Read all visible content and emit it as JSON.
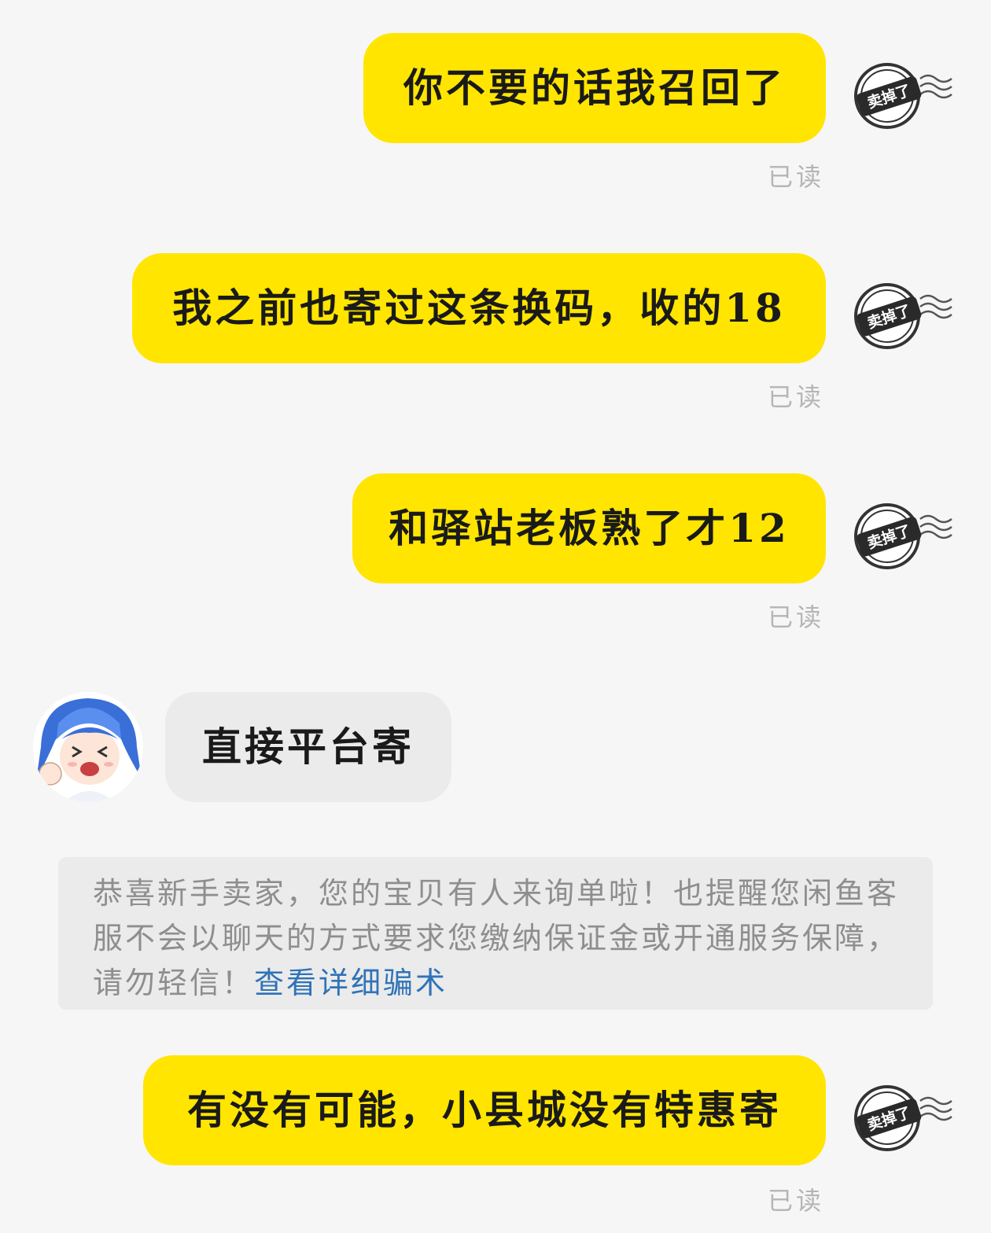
{
  "messages": [
    {
      "text": "你不要的话我召回了",
      "status": "已读"
    },
    {
      "text": "我之前也寄过这条换码，收的18",
      "status": "已读"
    },
    {
      "text": "和驿站老板熟了才12",
      "status": "已读"
    },
    {
      "text": "直接平台寄"
    },
    {
      "text": "有没有可能，小县城没有特惠寄",
      "status": "已读"
    }
  ],
  "stamp_label": "卖掉了",
  "notice": {
    "text": "恭喜新手卖家，您的宝贝有人来询单啦！也提醒您闲鱼客服不会以聊天的方式要求您缴纳保证金或开通服务保障，请勿轻信！",
    "link": "查看详细骗术"
  },
  "colors": {
    "outgoing_bubble": "#ffe500",
    "incoming_bubble": "#ebebeb",
    "link": "#2f73b8",
    "background": "#f6f6f6"
  },
  "icons": {
    "avatar": "anime-girl-avatar",
    "stamp": "sold-stamp-icon"
  }
}
